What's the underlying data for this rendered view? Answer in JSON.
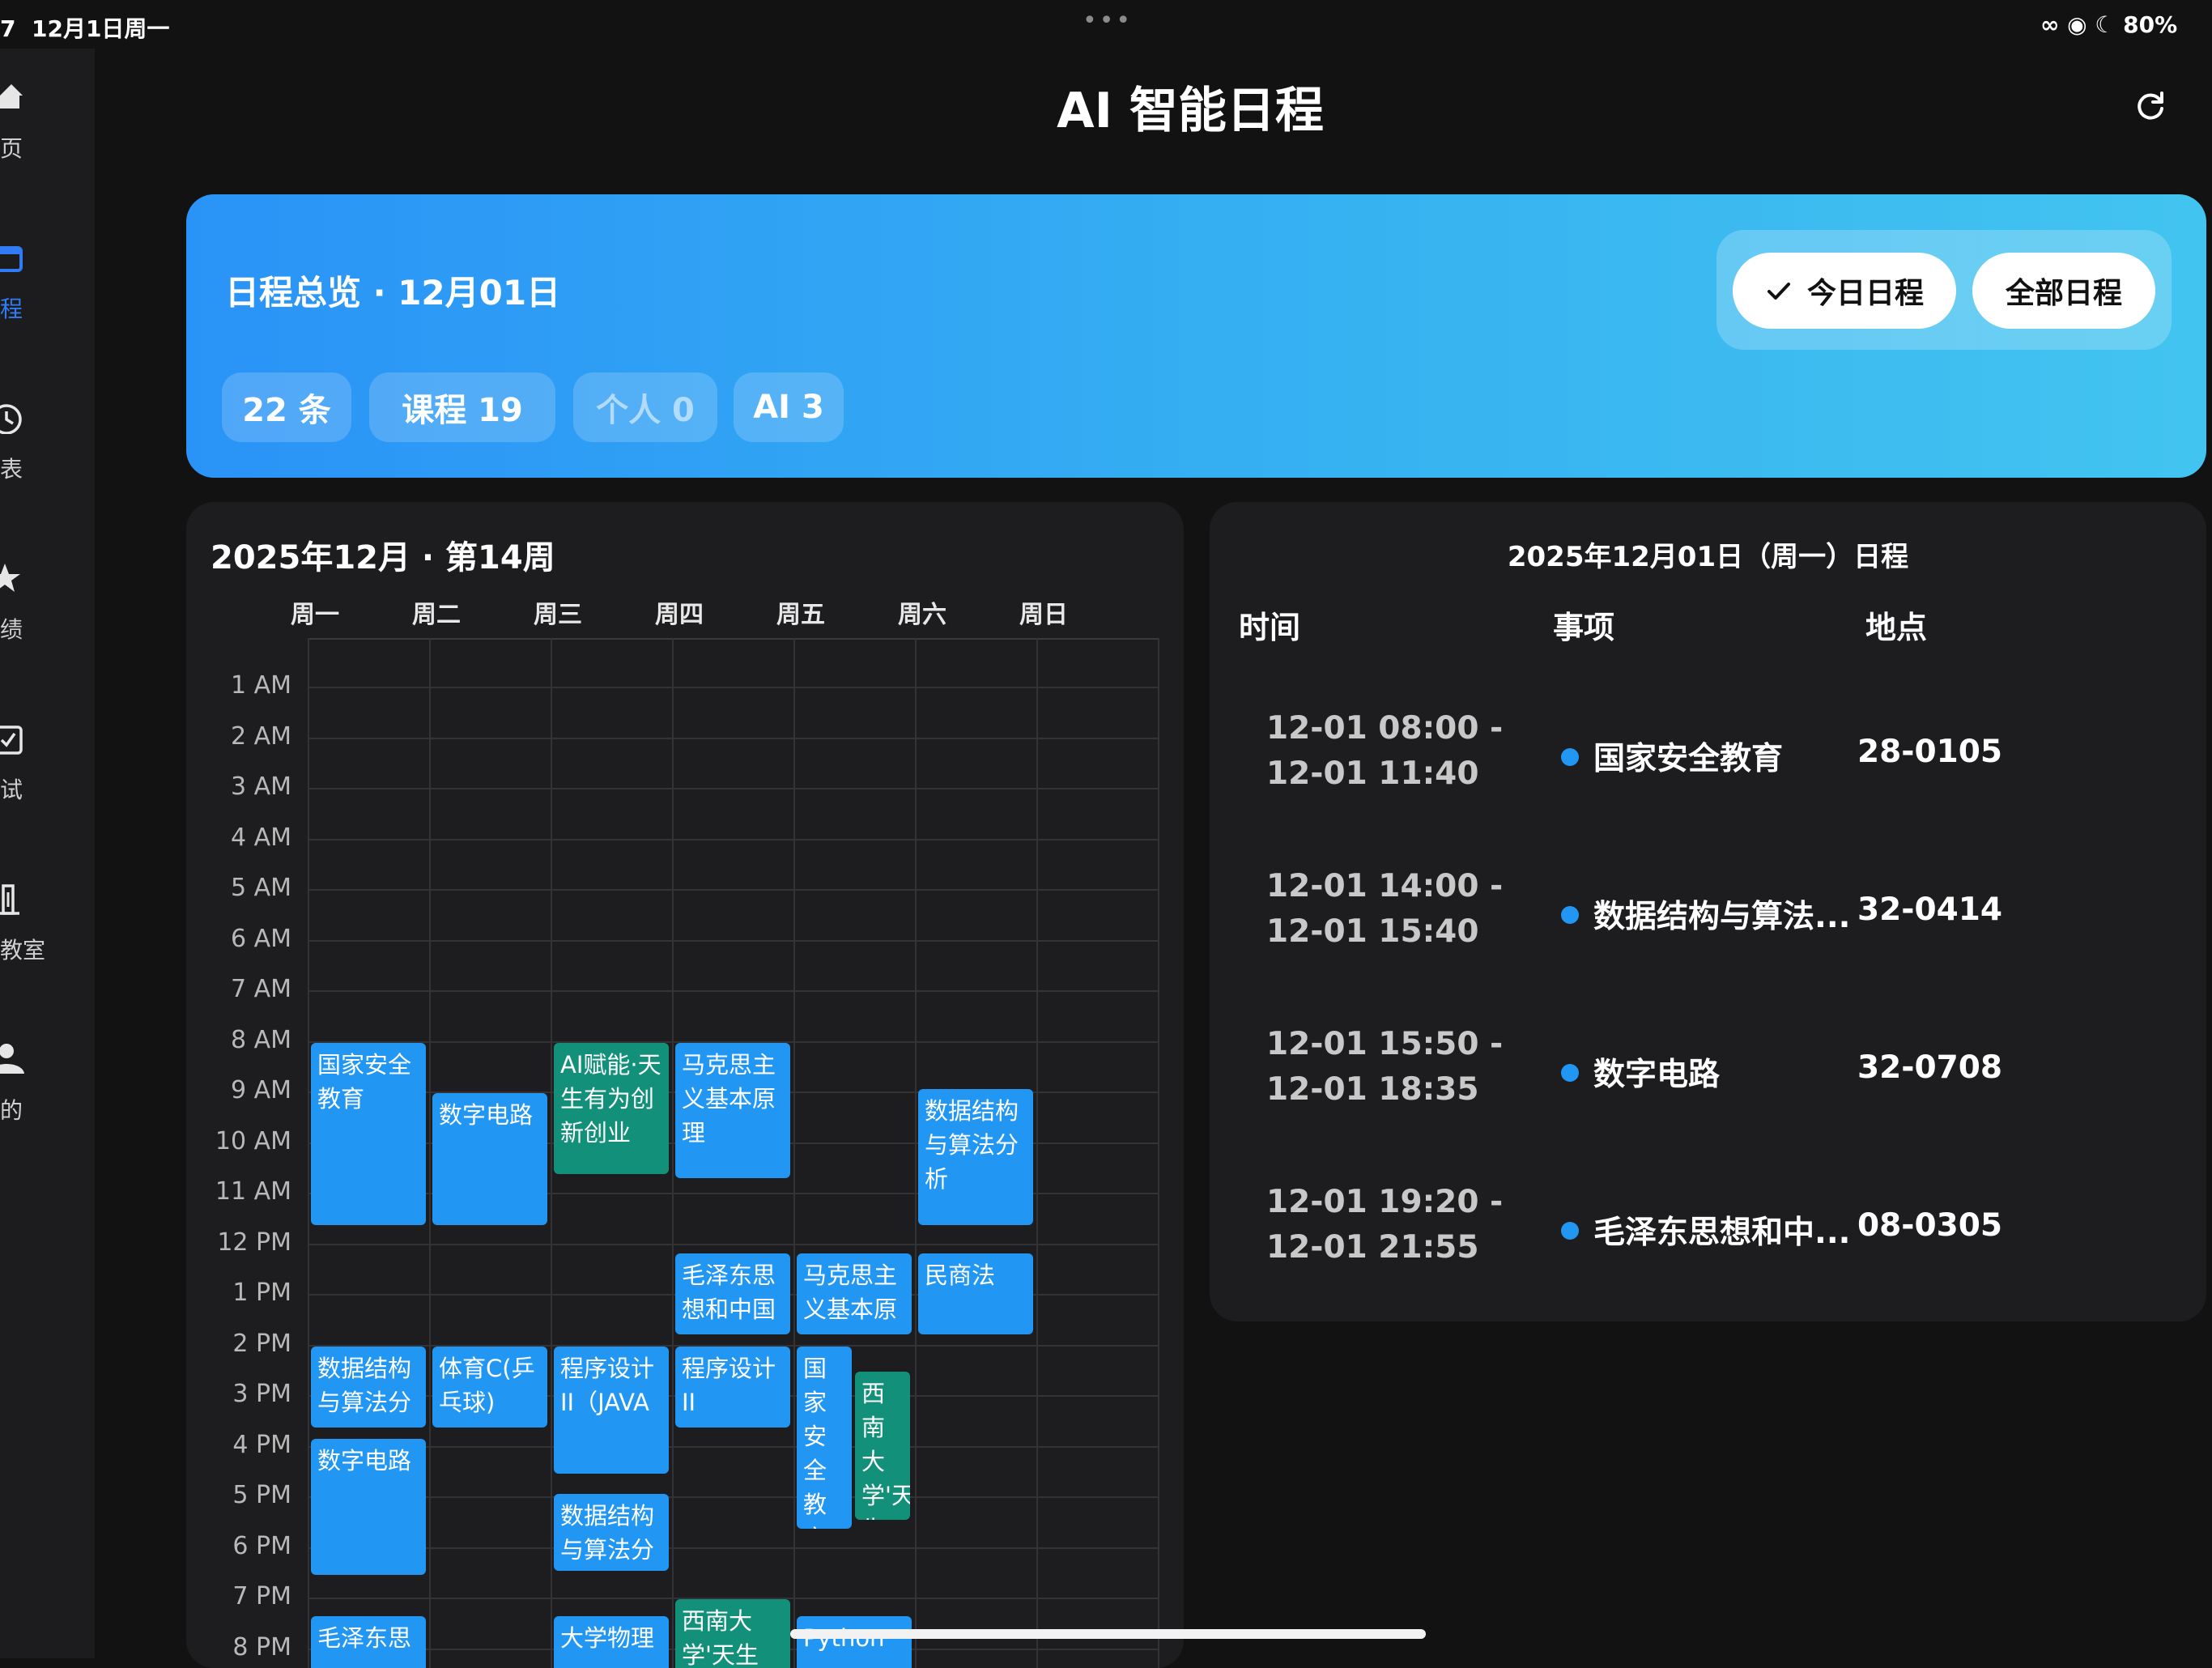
{
  "status_bar": {
    "time": "7",
    "date": "12月1日周一",
    "dots": "•••",
    "battery": "80%"
  },
  "sidebar": {
    "items": [
      {
        "label": "页",
        "icon": "home-icon",
        "active": false
      },
      {
        "label": "程",
        "icon": "calendar-icon",
        "active": true
      },
      {
        "label": "表",
        "icon": "clock-icon",
        "active": false
      },
      {
        "label": "绩",
        "icon": "star-icon",
        "active": false
      },
      {
        "label": "试",
        "icon": "checkbox-icon",
        "active": false
      },
      {
        "label": "教室",
        "icon": "building-icon",
        "active": false
      },
      {
        "label": "的",
        "icon": "person-icon",
        "active": false
      }
    ]
  },
  "header": {
    "title": "AI 智能日程",
    "refresh_icon": "refresh-icon"
  },
  "banner": {
    "title": "日程总览 · 12月01日",
    "chips": [
      "22 条",
      "课程 19",
      "个人 0",
      "AI 3"
    ],
    "toggle": {
      "today_label": "今日日程",
      "all_label": "全部日程",
      "selected": "today"
    }
  },
  "week_view": {
    "title": "2025年12月 · 第14周",
    "days": [
      "周一",
      "周二",
      "周三",
      "周四",
      "周五",
      "周六",
      "周日"
    ],
    "hours": [
      "1 AM",
      "2 AM",
      "3 AM",
      "4 AM",
      "5 AM",
      "6 AM",
      "7 AM",
      "8 AM",
      "9 AM",
      "10 AM",
      "11 AM",
      "12 PM",
      "1 PM",
      "2 PM",
      "3 PM",
      "4 PM",
      "5 PM",
      "6 PM",
      "7 PM",
      "8 PM"
    ],
    "events": [
      {
        "day": 0,
        "start": 8.0,
        "end": 11.67,
        "title": "国家安全教育",
        "color": "blue"
      },
      {
        "day": 1,
        "start": 9.0,
        "end": 11.67,
        "title": "数字电路",
        "color": "blue"
      },
      {
        "day": 2,
        "start": 8.0,
        "end": 10.67,
        "title": "AI赋能·天生有为创新创业",
        "color": "teal"
      },
      {
        "day": 3,
        "start": 8.0,
        "end": 10.75,
        "title": "马克思主义基本原理",
        "color": "blue"
      },
      {
        "day": 5,
        "start": 8.92,
        "end": 11.67,
        "title": "数据结构与算法分析",
        "color": "blue"
      },
      {
        "day": 3,
        "start": 12.17,
        "end": 13.83,
        "title": "毛泽东思想和中国",
        "color": "blue"
      },
      {
        "day": 4,
        "start": 12.17,
        "end": 13.83,
        "title": "马克思主义基本原",
        "color": "blue"
      },
      {
        "day": 5,
        "start": 12.17,
        "end": 13.83,
        "title": "民商法",
        "color": "blue"
      },
      {
        "day": 0,
        "start": 14.0,
        "end": 15.67,
        "title": "数据结构与算法分",
        "color": "blue"
      },
      {
        "day": 1,
        "start": 14.0,
        "end": 15.67,
        "title": "体育C(乒乓球)",
        "color": "blue"
      },
      {
        "day": 2,
        "start": 14.0,
        "end": 16.58,
        "title": "程序设计II（JAVA",
        "color": "blue"
      },
      {
        "day": 3,
        "start": 14.0,
        "end": 15.67,
        "title": "程序设计II",
        "color": "blue"
      },
      {
        "day": 4,
        "start": 14.0,
        "end": 17.67,
        "title": "国家安全教育",
        "color": "blue",
        "half": "left"
      },
      {
        "day": 4,
        "start": 14.5,
        "end": 17.5,
        "title": "西南大学'天生",
        "color": "teal",
        "half": "right"
      },
      {
        "day": 0,
        "start": 15.83,
        "end": 18.58,
        "title": "数字电路",
        "color": "blue"
      },
      {
        "day": 2,
        "start": 16.92,
        "end": 18.5,
        "title": "数据结构与算法分",
        "color": "blue"
      },
      {
        "day": 0,
        "start": 19.33,
        "end": 21.0,
        "title": "毛泽东思",
        "color": "blue"
      },
      {
        "day": 2,
        "start": 19.33,
        "end": 21.0,
        "title": "大学物理",
        "color": "blue"
      },
      {
        "day": 3,
        "start": 19.0,
        "end": 21.0,
        "title": "西南大学'天生",
        "color": "teal"
      },
      {
        "day": 4,
        "start": 19.33,
        "end": 21.0,
        "title": "Python",
        "color": "blue"
      }
    ]
  },
  "day_schedule": {
    "title": "2025年12月01日（周一）日程",
    "columns": [
      "时间",
      "事项",
      "地点"
    ],
    "rows": [
      {
        "time_start": "12-01 08:00 -",
        "time_end": "12-01 11:40",
        "title": "国家安全教育",
        "place": "28-0105"
      },
      {
        "time_start": "12-01 14:00 -",
        "time_end": "12-01 15:40",
        "title": "数据结构与算法...",
        "place": "32-0414"
      },
      {
        "time_start": "12-01 15:50 -",
        "time_end": "12-01 18:35",
        "title": "数字电路",
        "place": "32-0708"
      },
      {
        "time_start": "12-01 19:20 -",
        "time_end": "12-01 21:55",
        "title": "毛泽东思想和中...",
        "place": "08-0305"
      }
    ]
  },
  "colors": {
    "background": "#121212",
    "panel": "#1d1d1f",
    "accent_blue": "#2196f3",
    "accent_teal": "#12907a",
    "banner_start": "#2a93f7",
    "banner_end": "#42c4f0",
    "active_nav": "#2f7cf6"
  }
}
